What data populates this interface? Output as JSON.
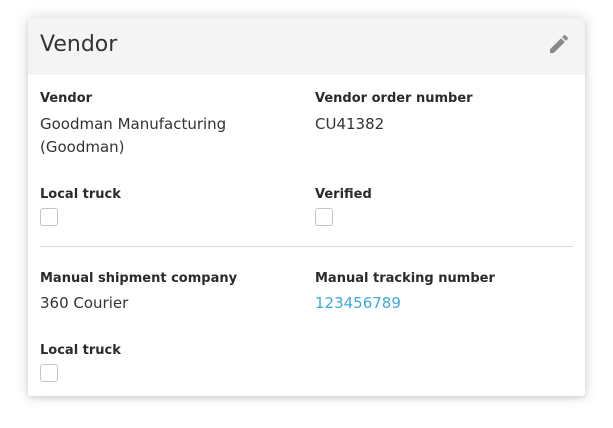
{
  "card": {
    "title": "Vendor",
    "edit_icon": "pencil-icon"
  },
  "vendor_section": {
    "vendor_label": "Vendor",
    "vendor_value_line1": "Goodman Manufacturing",
    "vendor_value_line2": "(Goodman)",
    "order_number_label": "Vendor order number",
    "order_number_value": "CU41382",
    "local_truck_label": "Local truck",
    "local_truck_checked": false,
    "verified_label": "Verified",
    "verified_checked": false
  },
  "shipment_section": {
    "company_label": "Manual shipment company",
    "company_value": "360 Courier",
    "tracking_label": "Manual tracking number",
    "tracking_value": "123456789",
    "local_truck_label": "Local truck",
    "local_truck_checked": false
  },
  "colors": {
    "header_bg": "#f4f4f4",
    "link": "#3ea8dc",
    "divider": "#d8d8d8"
  }
}
